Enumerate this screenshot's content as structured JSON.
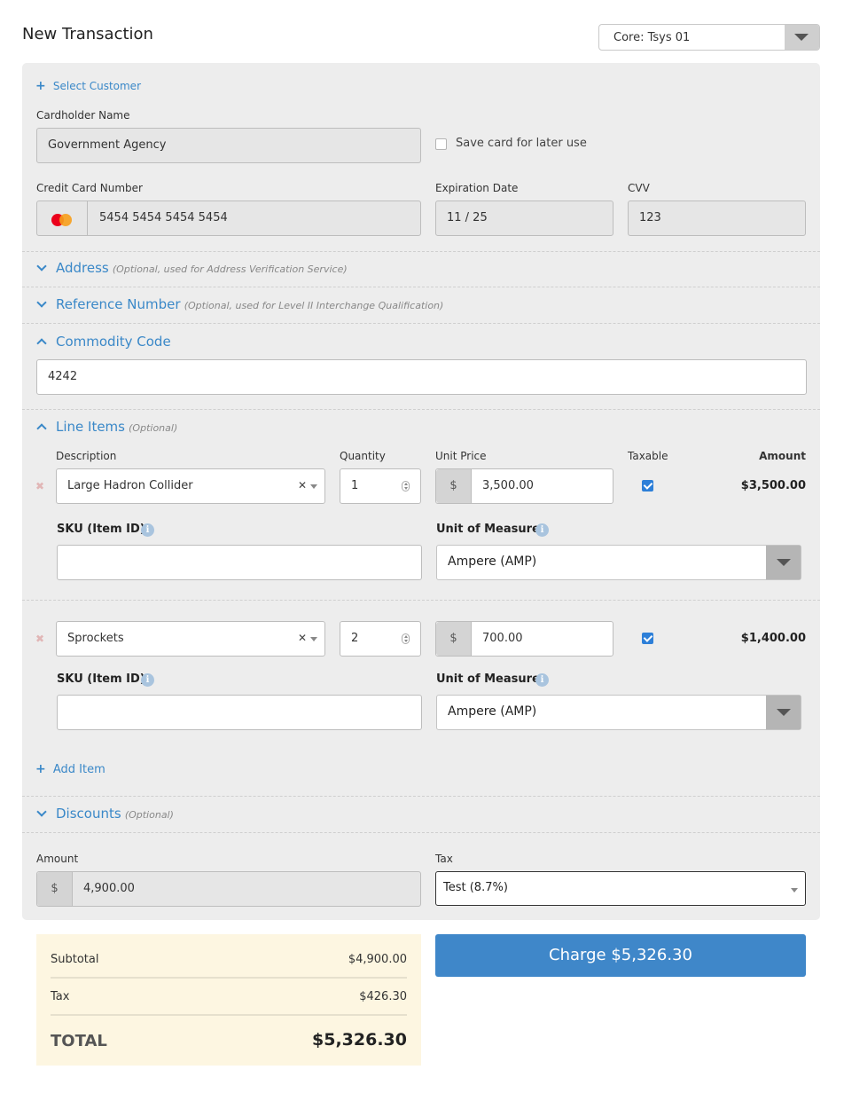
{
  "header": {
    "title": "New Transaction",
    "processor": "Core: Tsys 01"
  },
  "customer": {
    "select_label": "Select Customer"
  },
  "cardholder": {
    "label": "Cardholder Name",
    "value": "Government Agency",
    "save_card_label": "Save card for later use",
    "save_card_checked": false
  },
  "card": {
    "number_label": "Credit Card Number",
    "number": "5454 5454 5454 5454",
    "brand": "mastercard",
    "exp_label": "Expiration Date",
    "exp": "11 / 25",
    "cvv_label": "CVV",
    "cvv": "123"
  },
  "address": {
    "title": "Address",
    "note": "(Optional, used for Address Verification Service)",
    "expanded": false
  },
  "reference": {
    "title": "Reference Number",
    "note": "(Optional, used for Level II Interchange Qualification)",
    "expanded": false
  },
  "commodity": {
    "title": "Commodity Code",
    "value": "4242",
    "expanded": true
  },
  "line_items": {
    "title": "Line Items",
    "note": "(Optional)",
    "headers": {
      "description": "Description",
      "quantity": "Quantity",
      "unit_price": "Unit Price",
      "taxable": "Taxable",
      "amount": "Amount"
    },
    "sku_label": "SKU (Item ID)",
    "uom_label": "Unit of Measure",
    "currency_symbol": "$",
    "items": [
      {
        "description": "Large Hadron Collider",
        "quantity": "1",
        "unit_price": "3,500.00",
        "taxable": true,
        "amount": "$3,500.00",
        "sku": "",
        "uom": "Ampere (AMP)"
      },
      {
        "description": "Sprockets",
        "quantity": "2",
        "unit_price": "700.00",
        "taxable": true,
        "amount": "$1,400.00",
        "sku": "",
        "uom": "Ampere (AMP)"
      }
    ],
    "add_item_label": "Add Item"
  },
  "discounts": {
    "title": "Discounts",
    "note": "(Optional)",
    "expanded": false
  },
  "payment": {
    "amount_label": "Amount",
    "amount": "4,900.00",
    "tax_label": "Tax",
    "tax": "Test (8.7%)"
  },
  "summary": {
    "subtotal_label": "Subtotal",
    "subtotal": "$4,900.00",
    "tax_label": "Tax",
    "tax": "$426.30",
    "total_label": "TOTAL",
    "total": "$5,326.30"
  },
  "charge_button": "Charge $5,326.30",
  "colors": {
    "accent": "#3a88c8",
    "button": "#3f87c9",
    "panel": "#ededed",
    "summary_bg": "#fdf6e1",
    "check": "#2d7fd8"
  }
}
